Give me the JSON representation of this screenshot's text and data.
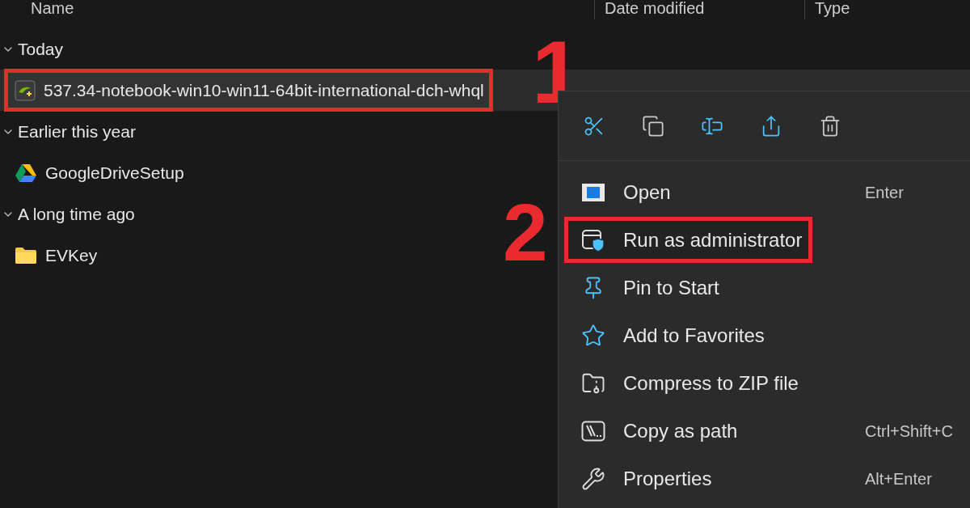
{
  "columns": [
    {
      "label": "Name"
    },
    {
      "label": "Date modified"
    },
    {
      "label": "Type"
    }
  ],
  "groups": [
    {
      "label": "Today",
      "expanded": true,
      "items": [
        {
          "name": "537.34-notebook-win10-win11-64bit-international-dch-whql",
          "kind": "installer",
          "selected": true,
          "callout": "1"
        }
      ]
    },
    {
      "label": "Earlier this year",
      "expanded": true,
      "items": [
        {
          "name": "GoogleDriveSetup",
          "kind": "drive",
          "selected": false
        }
      ]
    },
    {
      "label": "A long time ago",
      "expanded": true,
      "items": [
        {
          "name": "EVKey",
          "kind": "folder",
          "selected": false
        }
      ]
    }
  ],
  "context_menu": {
    "items": [
      {
        "label": "Open",
        "shortcut": "Enter"
      },
      {
        "label": "Run as administrator",
        "callout": "2"
      },
      {
        "label": "Pin to Start"
      },
      {
        "label": "Add to Favorites"
      },
      {
        "label": "Compress to ZIP file"
      },
      {
        "label": "Copy as path",
        "shortcut": "Ctrl+Shift+C"
      },
      {
        "label": "Properties",
        "shortcut": "Alt+Enter"
      }
    ]
  }
}
